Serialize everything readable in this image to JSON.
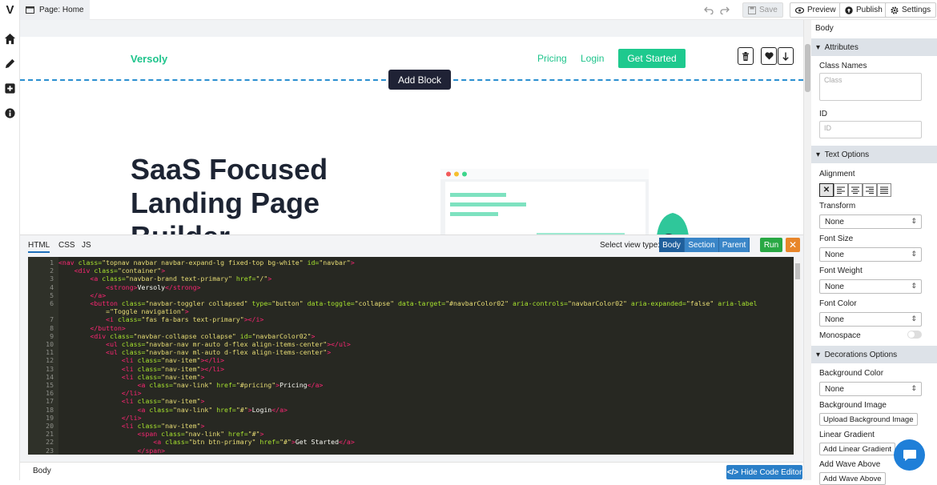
{
  "app": {
    "logo": "V",
    "page_tab": "Page: Home"
  },
  "toolbar": {
    "save": "Save",
    "preview": "Preview",
    "publish": "Publish",
    "settings": "Settings"
  },
  "canvas": {
    "brand": "Versoly",
    "nav": [
      "Pricing",
      "Login"
    ],
    "cta": "Get Started",
    "add_block": "Add Block",
    "hero": [
      "SaaS Focused",
      "Landing Page",
      "Builder"
    ]
  },
  "code_panel": {
    "tabs": [
      "HTML",
      "CSS",
      "JS"
    ],
    "view_label": "Select view type:",
    "view_types": [
      "Body",
      "Section",
      "Parent"
    ],
    "run": "Run",
    "close": "✕"
  },
  "code_lines": [
    {
      "n": "1",
      "c": [
        [
          "t",
          "<nav "
        ],
        [
          "a",
          "class="
        ],
        [
          "s",
          "\"topnav navbar navbar-expand-lg fixed-top bg-white\" "
        ],
        [
          "a",
          "id="
        ],
        [
          "s",
          "\"navbar\""
        ],
        [
          "t",
          ">"
        ]
      ]
    },
    {
      "n": "2",
      "c": [
        [
          "",
          "    "
        ],
        [
          "t",
          "<div "
        ],
        [
          "a",
          "class="
        ],
        [
          "s",
          "\"container\""
        ],
        [
          "t",
          ">"
        ]
      ]
    },
    {
      "n": "3",
      "c": [
        [
          "",
          "        "
        ],
        [
          "t",
          "<a "
        ],
        [
          "a",
          "class="
        ],
        [
          "s",
          "\"navbar-brand text-primary\" "
        ],
        [
          "a",
          "href="
        ],
        [
          "s",
          "\"/\""
        ],
        [
          "t",
          ">"
        ]
      ]
    },
    {
      "n": "4",
      "c": [
        [
          "",
          "            "
        ],
        [
          "t",
          "<strong>"
        ],
        [
          "",
          "Versoly"
        ],
        [
          "t",
          "</strong>"
        ]
      ]
    },
    {
      "n": "5",
      "c": [
        [
          "",
          "        "
        ],
        [
          "t",
          "</a>"
        ]
      ]
    },
    {
      "n": "6",
      "c": [
        [
          "",
          "        "
        ],
        [
          "t",
          "<button "
        ],
        [
          "a",
          "class="
        ],
        [
          "s",
          "\"navbar-toggler collapsed\" "
        ],
        [
          "a",
          "type="
        ],
        [
          "s",
          "\"button\" "
        ],
        [
          "a",
          "data-toggle="
        ],
        [
          "s",
          "\"collapse\" "
        ],
        [
          "a",
          "data-target="
        ],
        [
          "s",
          "\"#navbarColor02\" "
        ],
        [
          "a",
          "aria-controls="
        ],
        [
          "s",
          "\"navbarColor02\" "
        ],
        [
          "a",
          "aria-expanded="
        ],
        [
          "s",
          "\"false\" "
        ],
        [
          "a",
          "aria-label"
        ]
      ]
    },
    {
      "n": "",
      "c": [
        [
          "s",
          "            =\"Toggle navigation\""
        ],
        [
          "t",
          ">"
        ]
      ]
    },
    {
      "n": "7",
      "c": [
        [
          "",
          "            "
        ],
        [
          "t",
          "<i "
        ],
        [
          "a",
          "class="
        ],
        [
          "s",
          "\"fas fa-bars text-primary\""
        ],
        [
          "t",
          "></i>"
        ]
      ]
    },
    {
      "n": "8",
      "c": [
        [
          "",
          "        "
        ],
        [
          "t",
          "</button>"
        ]
      ]
    },
    {
      "n": "9",
      "c": [
        [
          "",
          "        "
        ],
        [
          "t",
          "<div "
        ],
        [
          "a",
          "class="
        ],
        [
          "s",
          "\"navbar-collapse collapse\" "
        ],
        [
          "a",
          "id="
        ],
        [
          "s",
          "\"navbarColor02\""
        ],
        [
          "t",
          ">"
        ]
      ]
    },
    {
      "n": "10",
      "c": [
        [
          "",
          "            "
        ],
        [
          "t",
          "<ul "
        ],
        [
          "a",
          "class="
        ],
        [
          "s",
          "\"navbar-nav mr-auto d-flex align-items-center\""
        ],
        [
          "t",
          "></ul>"
        ]
      ]
    },
    {
      "n": "11",
      "c": [
        [
          "",
          "            "
        ],
        [
          "t",
          "<ul "
        ],
        [
          "a",
          "class="
        ],
        [
          "s",
          "\"navbar-nav ml-auto d-flex align-items-center\""
        ],
        [
          "t",
          ">"
        ]
      ]
    },
    {
      "n": "12",
      "c": [
        [
          "",
          "                "
        ],
        [
          "t",
          "<li "
        ],
        [
          "a",
          "class="
        ],
        [
          "s",
          "\"nav-item\""
        ],
        [
          "t",
          "></li>"
        ]
      ]
    },
    {
      "n": "13",
      "c": [
        [
          "",
          "                "
        ],
        [
          "t",
          "<li "
        ],
        [
          "a",
          "class="
        ],
        [
          "s",
          "\"nav-item\""
        ],
        [
          "t",
          "></li>"
        ]
      ]
    },
    {
      "n": "14",
      "c": [
        [
          "",
          "                "
        ],
        [
          "t",
          "<li "
        ],
        [
          "a",
          "class="
        ],
        [
          "s",
          "\"nav-item\""
        ],
        [
          "t",
          ">"
        ]
      ]
    },
    {
      "n": "15",
      "c": [
        [
          "",
          "                    "
        ],
        [
          "t",
          "<a "
        ],
        [
          "a",
          "class="
        ],
        [
          "s",
          "\"nav-link\" "
        ],
        [
          "a",
          "href="
        ],
        [
          "s",
          "\"#pricing\""
        ],
        [
          "t",
          ">"
        ],
        [
          "",
          "Pricing"
        ],
        [
          "t",
          "</a>"
        ]
      ]
    },
    {
      "n": "16",
      "c": [
        [
          "",
          "                "
        ],
        [
          "t",
          "</li>"
        ]
      ]
    },
    {
      "n": "17",
      "c": [
        [
          "",
          "                "
        ],
        [
          "t",
          "<li "
        ],
        [
          "a",
          "class="
        ],
        [
          "s",
          "\"nav-item\""
        ],
        [
          "t",
          ">"
        ]
      ]
    },
    {
      "n": "18",
      "c": [
        [
          "",
          "                    "
        ],
        [
          "t",
          "<a "
        ],
        [
          "a",
          "class="
        ],
        [
          "s",
          "\"nav-link\" "
        ],
        [
          "a",
          "href="
        ],
        [
          "s",
          "\"#\""
        ],
        [
          "t",
          ">"
        ],
        [
          "",
          "Login"
        ],
        [
          "t",
          "</a>"
        ]
      ]
    },
    {
      "n": "19",
      "c": [
        [
          "",
          "                "
        ],
        [
          "t",
          "</li>"
        ]
      ]
    },
    {
      "n": "20",
      "c": [
        [
          "",
          "                "
        ],
        [
          "t",
          "<li "
        ],
        [
          "a",
          "class="
        ],
        [
          "s",
          "\"nav-item\""
        ],
        [
          "t",
          ">"
        ]
      ]
    },
    {
      "n": "21",
      "c": [
        [
          "",
          "                    "
        ],
        [
          "t",
          "<span "
        ],
        [
          "a",
          "class="
        ],
        [
          "s",
          "\"nav-link\" "
        ],
        [
          "a",
          "href="
        ],
        [
          "s",
          "\"#\""
        ],
        [
          "t",
          ">"
        ]
      ]
    },
    {
      "n": "22",
      "c": [
        [
          "",
          "                        "
        ],
        [
          "t",
          "<a "
        ],
        [
          "a",
          "class="
        ],
        [
          "s",
          "\"btn btn-primary\" "
        ],
        [
          "a",
          "href="
        ],
        [
          "s",
          "\"#\""
        ],
        [
          "t",
          ">"
        ],
        [
          "",
          "Get Started"
        ],
        [
          "t",
          "</a>"
        ]
      ]
    },
    {
      "n": "23",
      "c": [
        [
          "",
          "                    "
        ],
        [
          "t",
          "</span>"
        ]
      ]
    }
  ],
  "bottom": {
    "crumb": "Body",
    "hide_code": "Hide Code Editor"
  },
  "sidebar": {
    "title": "Body",
    "attributes": {
      "header": "Attributes",
      "class_label": "Class Names",
      "class_placeholder": "Class",
      "id_label": "ID",
      "id_placeholder": "ID"
    },
    "text": {
      "header": "Text Options",
      "alignment": "Alignment",
      "transform": "Transform",
      "transform_val": "None",
      "font_size": "Font Size",
      "font_size_val": "None",
      "font_weight": "Font Weight",
      "font_weight_val": "None",
      "font_color": "Font Color",
      "font_color_val": "None",
      "monospace": "Monospace"
    },
    "deco": {
      "header": "Decorations Options",
      "bg_color": "Background Color",
      "bg_color_val": "None",
      "bg_image": "Background Image",
      "upload_bg": "Upload Background Image",
      "linear": "Linear Gradient",
      "add_linear": "Add Linear Gradient",
      "wave_above": "Add Wave Above",
      "add_wave_above": "Add Wave Above"
    }
  },
  "colors": {
    "accent": "#1fc48c",
    "primary": "#2a7fc8",
    "run": "#29a844",
    "close": "#e8862a"
  }
}
